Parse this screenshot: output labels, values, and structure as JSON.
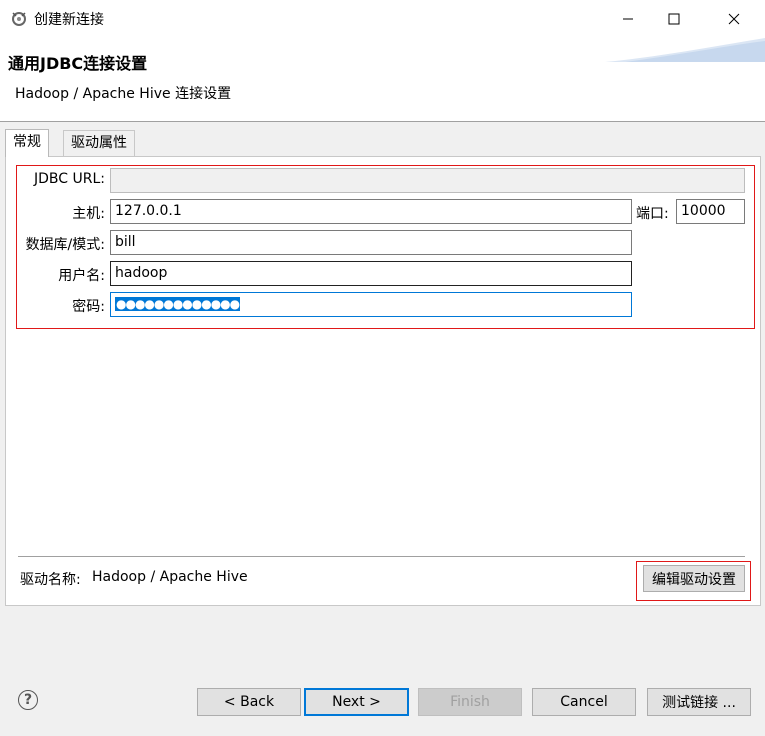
{
  "window": {
    "title": "创建新连接",
    "minimize": "—",
    "maximize": "☐",
    "close": "✕"
  },
  "header": {
    "title": "通用JDBC连接设置",
    "subtitle": "Hadoop / Apache Hive 连接设置"
  },
  "tabs": [
    {
      "label": "常规",
      "active": true
    },
    {
      "label": "驱动属性",
      "active": false
    }
  ],
  "form": {
    "jdbc_url": {
      "label": "JDBC URL:",
      "value": ""
    },
    "host": {
      "label": "主机:",
      "value": "127.0.0.1"
    },
    "port": {
      "label": "端口:",
      "value": "10000"
    },
    "database": {
      "label": "数据库/模式:",
      "value": "bill"
    },
    "username": {
      "label": "用户名:",
      "value": "hadoop"
    },
    "password": {
      "label": "密码:",
      "value": "●●●●●●●●●●●●●"
    }
  },
  "driver": {
    "label": "驱动名称:",
    "name": "Hadoop / Apache Hive",
    "edit_button": "编辑驱动设置"
  },
  "footer": {
    "help": "?",
    "back": "< Back",
    "next": "Next >",
    "finish": "Finish",
    "cancel": "Cancel",
    "test": "测试链接 ..."
  },
  "colors": {
    "accent": "#0078d7",
    "highlight_border": "#e01818"
  }
}
